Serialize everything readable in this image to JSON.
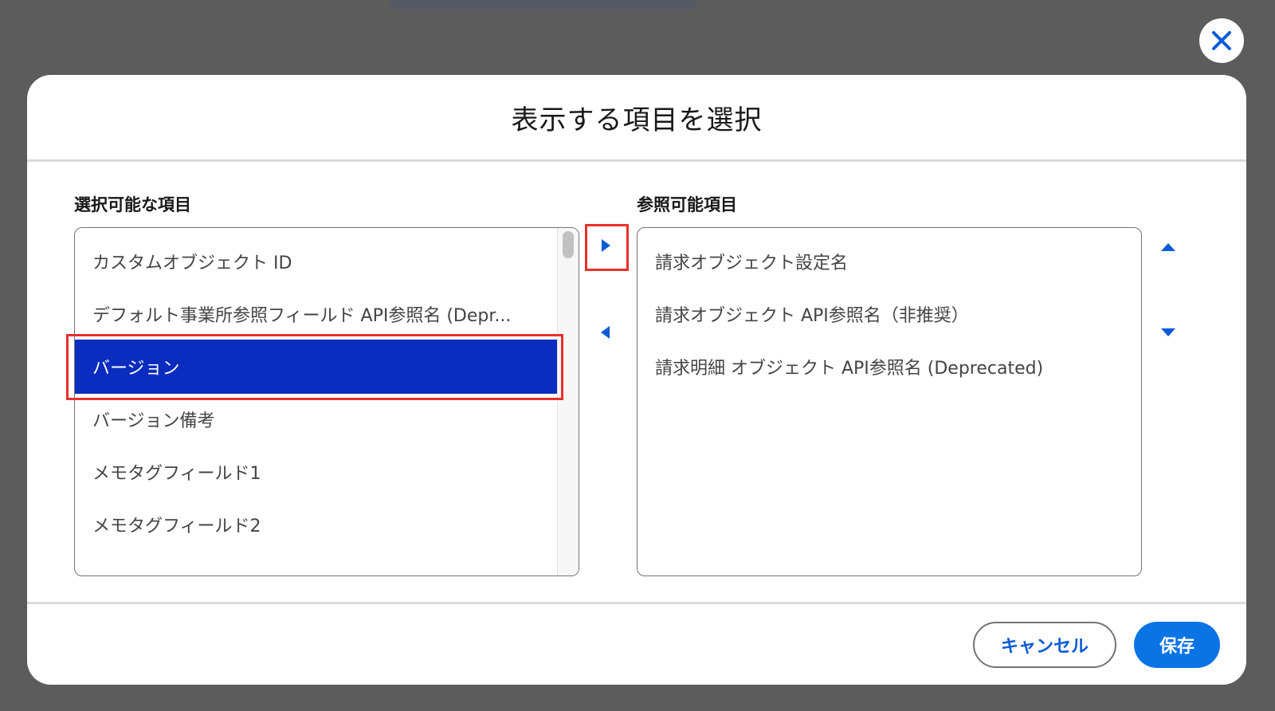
{
  "modal": {
    "title": "表示する項目を選択",
    "close_icon": "close-icon"
  },
  "available": {
    "label": "選択可能な項目",
    "items": [
      "カスタムオブジェクト ID",
      "デフォルト事業所参照フィールド API参照名 (Depr...",
      "バージョン",
      "バージョン備考",
      "メモタグフィールド1",
      "メモタグフィールド2"
    ],
    "selected_index": 2
  },
  "visible": {
    "label": "参照可能項目",
    "items": [
      "請求オブジェクト設定名",
      "請求オブジェクト API参照名（非推奨）",
      "請求明細 オブジェクト API参照名 (Deprecated)"
    ]
  },
  "controls": {
    "move_right_icon": "triangle-right-icon",
    "move_left_icon": "triangle-left-icon",
    "move_up_icon": "triangle-up-icon",
    "move_down_icon": "triangle-down-icon"
  },
  "footer": {
    "cancel_label": "キャンセル",
    "save_label": "保存"
  },
  "colors": {
    "accent": "#0b74e5",
    "selected_bg": "#0a2dbf",
    "highlight": "#e8302a",
    "icon": "#0b5cd5"
  }
}
